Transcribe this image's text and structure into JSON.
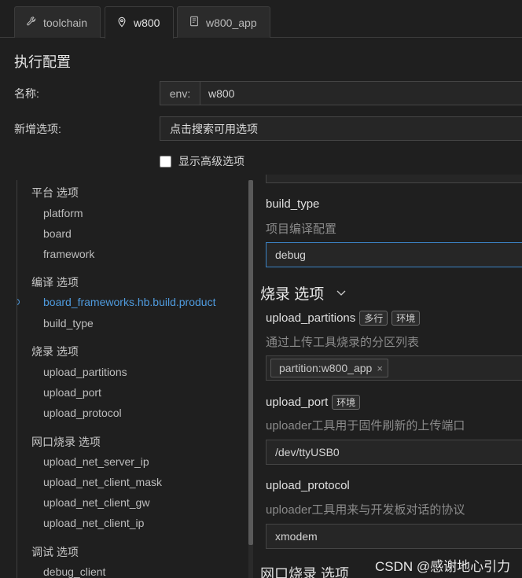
{
  "tabs": [
    {
      "label": "toolchain",
      "icon": "wrench-icon"
    },
    {
      "label": "w800",
      "icon": "location-pin-icon"
    },
    {
      "label": "w800_app",
      "icon": "book-icon"
    }
  ],
  "section_title": "执行配置",
  "form": {
    "name_label": "名称:",
    "env_prefix": "env:",
    "env_value": "w800",
    "add_label": "新增选项:",
    "add_placeholder": "点击搜索可用选项",
    "advanced_label": "显示高级选项"
  },
  "tree": {
    "groups": [
      {
        "label": "平台 选项",
        "items": [
          "platform",
          "board",
          "framework"
        ]
      },
      {
        "label": "编译 选项",
        "items": [
          "board_frameworks.hb.build.product",
          "build_type"
        ]
      },
      {
        "label": "烧录 选项",
        "items": [
          "upload_partitions",
          "upload_port",
          "upload_protocol"
        ]
      },
      {
        "label": "网口烧录 选项",
        "items": [
          "upload_net_server_ip",
          "upload_net_client_mask",
          "upload_net_client_gw",
          "upload_net_client_ip"
        ]
      },
      {
        "label": "调试 选项",
        "items": [
          "debug_client"
        ]
      }
    ]
  },
  "fields": {
    "build_type": {
      "title": "build_type",
      "desc": "项目编译配置",
      "value": "debug"
    },
    "upload_group_title": "烧录 选项",
    "upload_partitions": {
      "title": "upload_partitions",
      "badges": [
        "多行",
        "环境"
      ],
      "desc": "通过上传工具烧录的分区列表",
      "chip": "partition:w800_app",
      "chip_close": "×"
    },
    "upload_port": {
      "title": "upload_port",
      "badges": [
        "环境"
      ],
      "desc": "uploader工具用于固件刷新的上传端口",
      "value": "/dev/ttyUSB0"
    },
    "upload_protocol": {
      "title": "upload_protocol",
      "desc": "uploader工具用来与开发板对话的协议",
      "value": "xmodem"
    },
    "next_group_title": "网口烧录 选项"
  },
  "watermark": "CSDN @感谢地心引力",
  "colors": {
    "accent": "#4f9bde",
    "background": "#1f1f1f"
  }
}
